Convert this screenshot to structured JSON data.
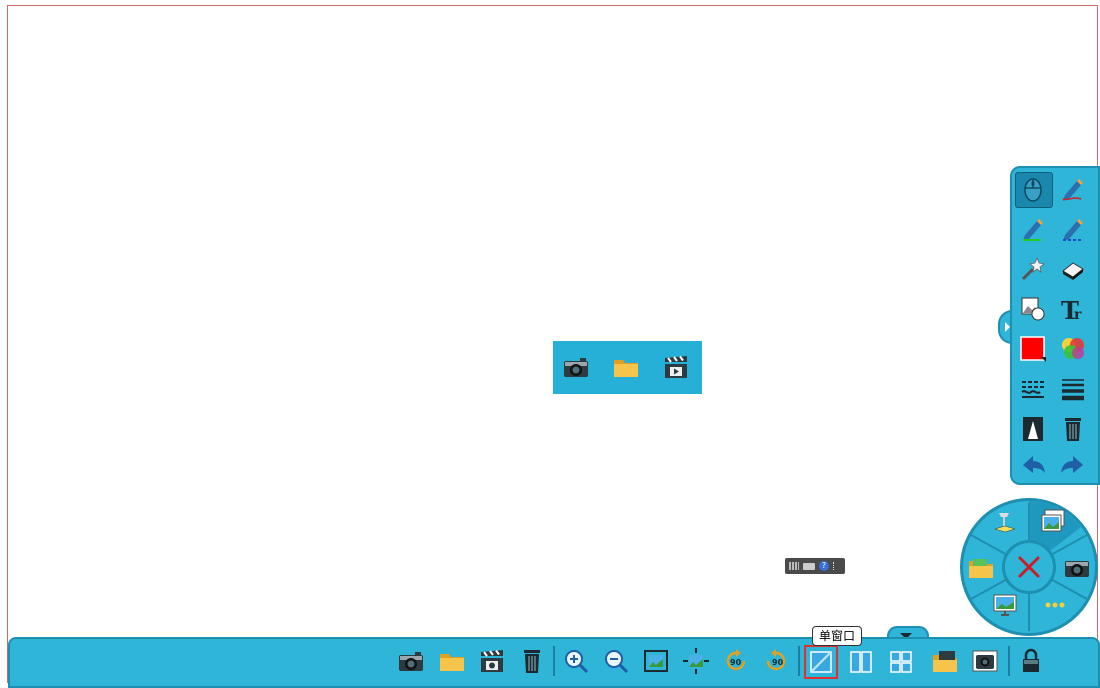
{
  "media_bar": {
    "items": [
      {
        "name": "camera-icon"
      },
      {
        "name": "folder-icon"
      },
      {
        "name": "video-clapper-icon"
      }
    ]
  },
  "side_toolbar": {
    "items": [
      {
        "name": "mouse-pointer-icon"
      },
      {
        "name": "pen-icon"
      },
      {
        "name": "highlighter-icon"
      },
      {
        "name": "laser-pen-icon"
      },
      {
        "name": "magic-wand-icon"
      },
      {
        "name": "eraser-icon"
      },
      {
        "name": "shape-icon"
      },
      {
        "name": "text-icon"
      },
      {
        "name": "color-swatch-icon",
        "color": "#ff0000"
      },
      {
        "name": "color-palette-icon"
      },
      {
        "name": "line-style-icon"
      },
      {
        "name": "line-width-icon"
      },
      {
        "name": "spotlight-icon"
      },
      {
        "name": "trash-icon"
      },
      {
        "name": "undo-icon"
      },
      {
        "name": "redo-icon"
      }
    ]
  },
  "radial_menu": {
    "items": [
      {
        "name": "document-camera-icon"
      },
      {
        "name": "image-gallery-icon"
      },
      {
        "name": "folder-open-icon"
      },
      {
        "name": "camera-icon"
      },
      {
        "name": "display-icon"
      },
      {
        "name": "more-icon"
      }
    ],
    "close": {
      "name": "close-icon"
    }
  },
  "bottom_toolbar": {
    "items": [
      {
        "name": "camera-icon"
      },
      {
        "name": "folder-icon"
      },
      {
        "name": "video-clapper-icon"
      },
      {
        "name": "trash-icon"
      },
      {
        "name": "zoom-in-icon"
      },
      {
        "name": "zoom-out-icon"
      },
      {
        "name": "fit-screen-icon"
      },
      {
        "name": "fit-width-icon"
      },
      {
        "name": "rotate-left-icon",
        "label": "90"
      },
      {
        "name": "rotate-right-icon",
        "label": "90"
      },
      {
        "name": "single-window-icon"
      },
      {
        "name": "dual-window-icon"
      },
      {
        "name": "quad-window-icon"
      },
      {
        "name": "media-folder-icon"
      },
      {
        "name": "capture-icon"
      },
      {
        "name": "lock-icon"
      }
    ],
    "tooltip": "单窗口"
  },
  "colors": {
    "accent": "#2fb5d8",
    "border": "#1d8fb0",
    "active_swatch": "#ff0000"
  }
}
